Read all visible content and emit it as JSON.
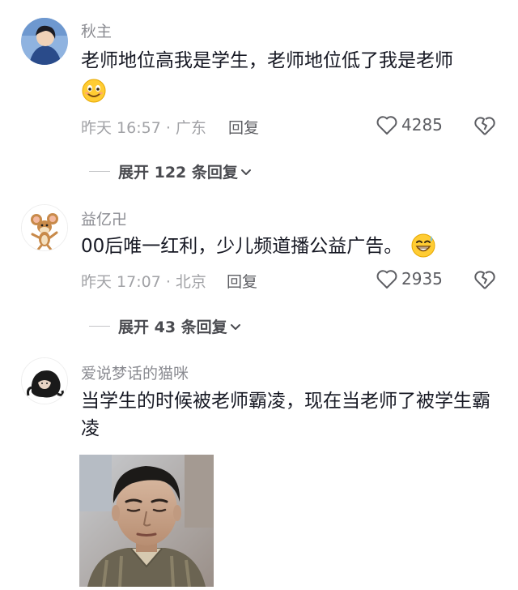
{
  "colors": {
    "username": "#8a8b91",
    "text": "#161823",
    "meta": "#a1a2a6",
    "action": "#5c5d62",
    "divider": "#c4c5c8"
  },
  "comments": [
    {
      "username": "秋主",
      "text": "老师地位高我是学生，老师地位低了我是老师",
      "emoji": "smiling-face-emoji",
      "time_location": "昨天 16:57 · 广东",
      "reply_label": "回复",
      "likes": "4285",
      "expand_label": "展开 122 条回复"
    },
    {
      "username": "益亿卍",
      "text": "00后唯一红利，少儿频道播公益广告。",
      "emoji": "grinning-sweat-emoji",
      "time_location": "昨天 17:07 · 北京",
      "reply_label": "回复",
      "likes": "2935",
      "expand_label": "展开 43 条回复"
    },
    {
      "username": "爱说梦话的猫咪",
      "text": "当学生的时候被老师霸凌，现在当老师了被学生霸凌",
      "image": "meme-photo"
    }
  ]
}
